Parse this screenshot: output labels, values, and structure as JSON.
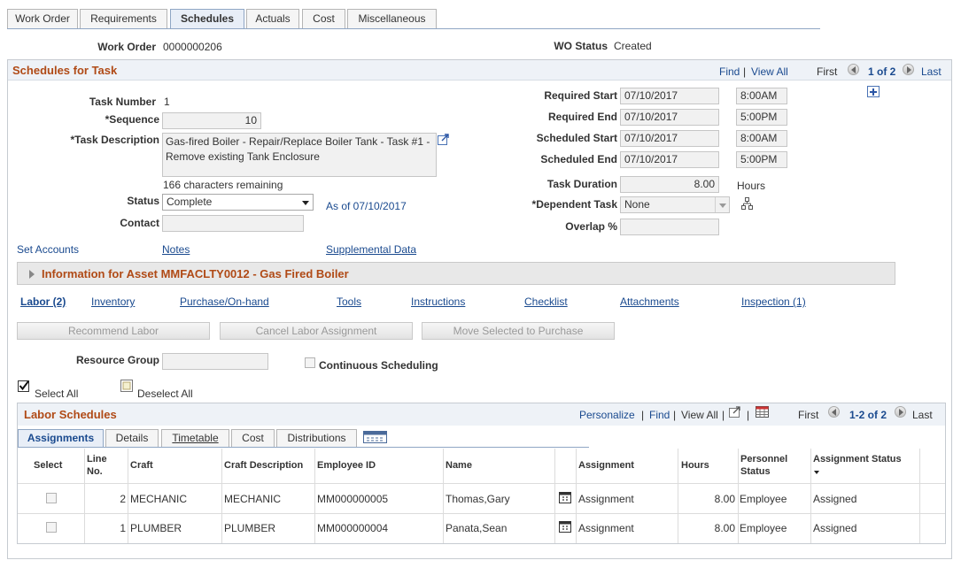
{
  "tabs": [
    {
      "label": "Work Order",
      "underline_index": 0
    },
    {
      "label": "Requirements"
    },
    {
      "label": "Schedules"
    },
    {
      "label": "Actuals"
    },
    {
      "label": "Cost"
    },
    {
      "label": "Miscellaneous"
    }
  ],
  "header": {
    "work_order_label": "Work Order",
    "work_order_value": "0000000206",
    "wo_status_label": "WO Status",
    "wo_status_value": "Created"
  },
  "schedules_for_task": {
    "title": "Schedules for Task",
    "find": "Find",
    "separator": "|",
    "view_all": "View All",
    "first": "First",
    "page": "1 of 2",
    "last": "Last"
  },
  "task": {
    "task_number_label": "Task Number",
    "task_number_value": "1",
    "sequence_label": "*Sequence",
    "sequence_value": "10",
    "task_description_label": "*Task Description",
    "task_description_value": "Gas-fired Boiler - Repair/Replace Boiler Tank - Task #1 - Remove existing Tank Enclosure",
    "chars_remaining": "166 characters remaining",
    "status_label": "Status",
    "status_value": "Complete",
    "as_of": "As of 07/10/2017",
    "contact_label": "Contact",
    "contact_value": ""
  },
  "dates": {
    "required_start_label": "Required Start",
    "required_start_date": "07/10/2017",
    "required_start_time": "8:00AM",
    "required_end_label": "Required End",
    "required_end_date": "07/10/2017",
    "required_end_time": "5:00PM",
    "scheduled_start_label": "Scheduled Start",
    "scheduled_start_date": "07/10/2017",
    "scheduled_start_time": "8:00AM",
    "scheduled_end_label": "Scheduled End",
    "scheduled_end_date": "07/10/2017",
    "scheduled_end_time": "5:00PM",
    "task_duration_label": "Task Duration",
    "task_duration_value": "8.00",
    "hours_unit": "Hours",
    "dependent_task_label": "*Dependent Task",
    "dependent_task_value": "None",
    "overlap_label": "Overlap %",
    "overlap_value": ""
  },
  "links_row1": {
    "set_accounts": "Set Accounts",
    "notes": "Notes",
    "supplemental_data": "Supplemental Data"
  },
  "asset_info": "Information for Asset MMFACLTY0012 - Gas Fired Boiler",
  "links_row2": [
    {
      "label": "Labor (2)"
    },
    {
      "label": "Inventory"
    },
    {
      "label": "Purchase/On-hand"
    },
    {
      "label": "Tools"
    },
    {
      "label": "Instructions"
    },
    {
      "label": "Checklist"
    },
    {
      "label": "Attachments"
    },
    {
      "label": "Inspection (1)"
    }
  ],
  "buttons": {
    "recommend_labor": "Recommend Labor",
    "cancel_labor_assignment": "Cancel Labor Assignment",
    "move_selected": "Move Selected to Purchase"
  },
  "resource_group_label": "Resource Group",
  "resource_group_value": "",
  "continuous_scheduling": "Continuous Scheduling",
  "select_all": "Select All",
  "deselect_all": "Deselect All",
  "labor_schedules": {
    "title": "Labor Schedules",
    "personalize": "Personalize",
    "find": "Find",
    "view_all": "View All",
    "separator": "|",
    "first": "First",
    "page": "1-2 of 2",
    "last": "Last"
  },
  "grid_tabs": [
    {
      "label": "Assignments"
    },
    {
      "label": "Details"
    },
    {
      "label": "Timetable"
    },
    {
      "label": "Cost"
    },
    {
      "label": "Distributions"
    }
  ],
  "columns": {
    "select": "Select",
    "line_no_1": "Line",
    "line_no_2": "No.",
    "craft": "Craft",
    "craft_description": "Craft Description",
    "employee_id": "Employee ID",
    "name": "Name",
    "assignment": "Assignment",
    "hours": "Hours",
    "personnel_status_1": "Personnel",
    "personnel_status_2": "Status",
    "assignment_status": "Assignment Status"
  },
  "rows": [
    {
      "line": "2",
      "craft": "MECHANIC",
      "craft_description": "MECHANIC",
      "employee_id": "MM000000005",
      "name": "Thomas,Gary",
      "assignment": "Assignment",
      "hours": "8.00",
      "personnel_status": "Employee",
      "assignment_status": "Assigned"
    },
    {
      "line": "1",
      "craft": "PLUMBER",
      "craft_description": "PLUMBER",
      "employee_id": "MM000000004",
      "name": "Panata,Sean",
      "assignment": "Assignment",
      "hours": "8.00",
      "personnel_status": "Employee",
      "assignment_status": "Assigned"
    }
  ]
}
